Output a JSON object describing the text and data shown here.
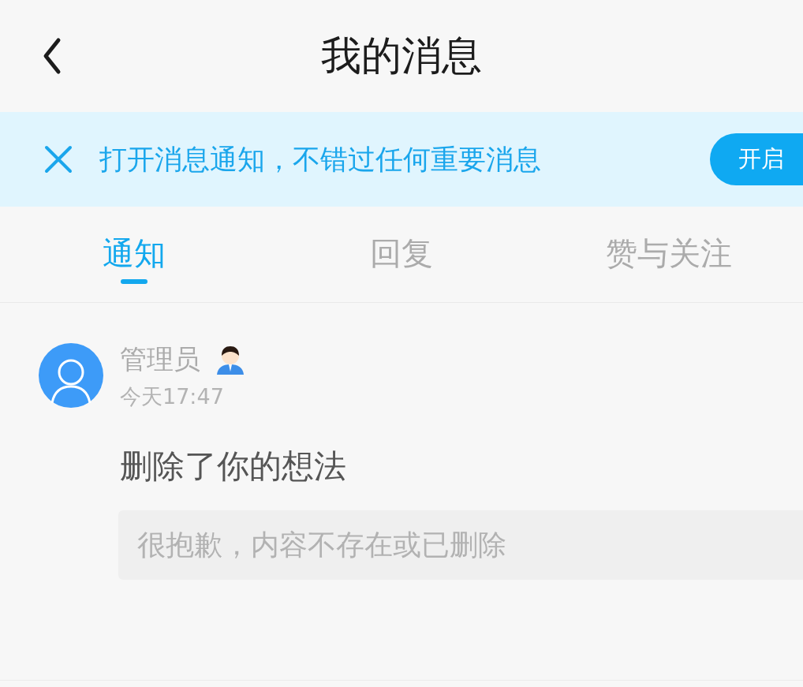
{
  "header": {
    "title": "我的消息"
  },
  "banner": {
    "text": "打开消息通知，不错过任何重要消息",
    "button": "开启"
  },
  "tabs": [
    {
      "label": "通知",
      "selected": true
    },
    {
      "label": "回复",
      "selected": false
    },
    {
      "label": "赞与关注",
      "selected": false
    }
  ],
  "messages": [
    {
      "sender": "管理员",
      "admin": true,
      "time": "今天17:47",
      "content": "删除了你的想法",
      "quote": "很抱歉，内容不存在或已删除"
    }
  ]
}
